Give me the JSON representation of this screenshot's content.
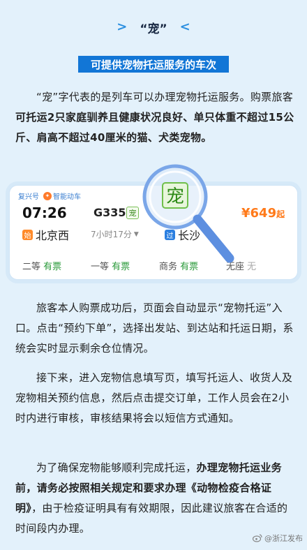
{
  "header": {
    "left_chevron": ">",
    "title": "“宠”",
    "right_chevron": "<"
  },
  "banner": {
    "text": "可提供宠物托运服务的车次"
  },
  "para1": {
    "t1": "“宠”字代表的是列车可以办理宠物托运服务。购票旅客",
    "t2": "可托运2只家庭驯养且健康状况良好、单只体重不超过15公斤、肩高不超过40厘米的猫、犬类宠物。"
  },
  "ticket": {
    "tag_fuxing": "复兴号",
    "tag_smart": "智能动车",
    "depart_time": "07:26",
    "train_no": "G335",
    "pet_mark": "宠",
    "arrive_time": "",
    "price_symbol": "¥",
    "price_value": "649",
    "price_suffix": "起",
    "depart_station_badge": "始",
    "depart_station": "北京西",
    "duration": "7小时17分",
    "arrive_station_badge": "过",
    "arrive_station": "长沙",
    "seats": [
      {
        "name": "二等",
        "status": "有票"
      },
      {
        "name": "一等",
        "status": "有票"
      },
      {
        "name": "商务",
        "status": "有票"
      },
      {
        "name": "无座",
        "status": "无"
      }
    ],
    "magnifier_char": "宠"
  },
  "para2": {
    "text": "旅客本人购票成功后，页面会自动显示“宠物托运”入口。点击“预约下单”，选择出发站、到达站和托运日期，系统会实时显示剩余仓位情况。"
  },
  "para3": {
    "text": "接下来，进入宠物信息填写页，填写托运人、收货人及宠物相关预约信息，然后点击提交订单，工作人员会在2小时内进行审核，审核结果将会以短信方式通知。"
  },
  "para4": {
    "t1": "为了确保宠物能够顺利完成托运，",
    "t2": "办理宠物托运业务前，请务必按照相关规定和要求办理《动物检疫合格证明》",
    "t3": "，由于检疫证明具有有效期限，因此建议旅客在合适的时间段内办理。"
  },
  "watermark": {
    "text": "@浙江发布"
  },
  "colors": {
    "accent": "#1276d6",
    "price": "#ff7a1a",
    "available": "#2a9a3a",
    "background": "#e3f1fb"
  }
}
